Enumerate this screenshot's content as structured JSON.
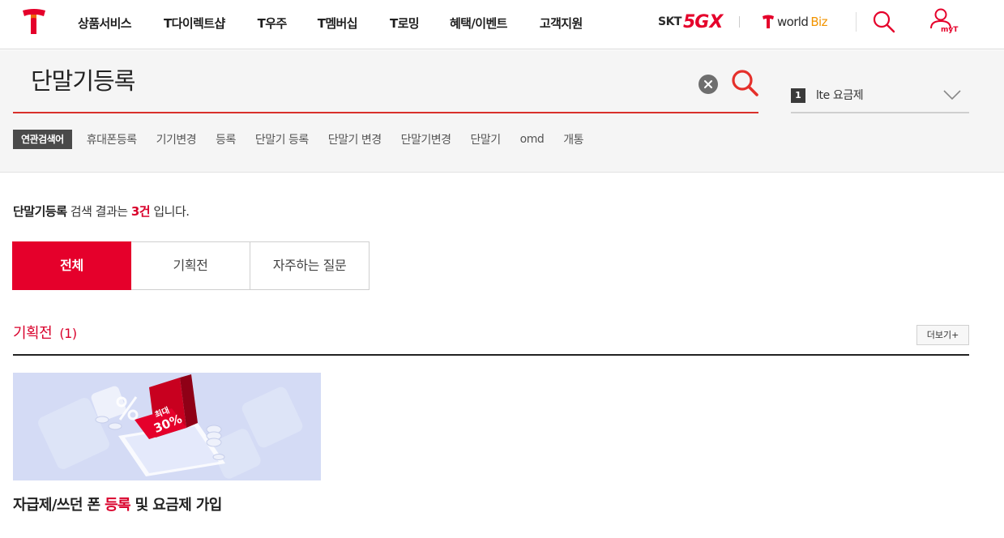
{
  "header": {
    "logo": "T",
    "menu": [
      "상품서비스",
      "T다이렉트샵",
      "T우주",
      "T멤버십",
      "T로밍",
      "혜택/이벤트",
      "고객지원"
    ],
    "skt5gx": {
      "skt": "SKT",
      "five_g": "5G",
      "x": "X"
    },
    "worldbiz": {
      "world": "world",
      "biz": "Biz"
    },
    "myt_label": "myT",
    "icons": {
      "search": "search-icon",
      "user": "user-icon"
    }
  },
  "search": {
    "query": "단말기등록",
    "clear_icon": "clear-icon",
    "search_icon": "search-icon"
  },
  "ranking": {
    "rank": "1",
    "keyword": "lte 요금제"
  },
  "related": {
    "title": "연관검색어",
    "keywords": [
      "휴대폰등록",
      "기기변경",
      "등록",
      "단말기 등록",
      "단말기 변경",
      "단말기변경",
      "단말기",
      "omd",
      "개통"
    ]
  },
  "result": {
    "keyword": "단말기등록",
    "middle": " 검색 결과는 ",
    "count": "3건",
    "suffix": " 입니다."
  },
  "tabs": [
    "전체",
    "기획전",
    "자주하는 질문"
  ],
  "section": {
    "title": "기획전",
    "count": "(1)",
    "more": "더보기+"
  },
  "card": {
    "thumb_text": [
      "최대",
      "30%"
    ],
    "title_before": "자급제/쓰던 폰 ",
    "title_highlight": "등록",
    "title_after": " 및 요금제 가입"
  },
  "colors": {
    "brand_red": "#e5002b",
    "accent_orange": "#f29400",
    "card_bg": "#d4dbf5"
  }
}
